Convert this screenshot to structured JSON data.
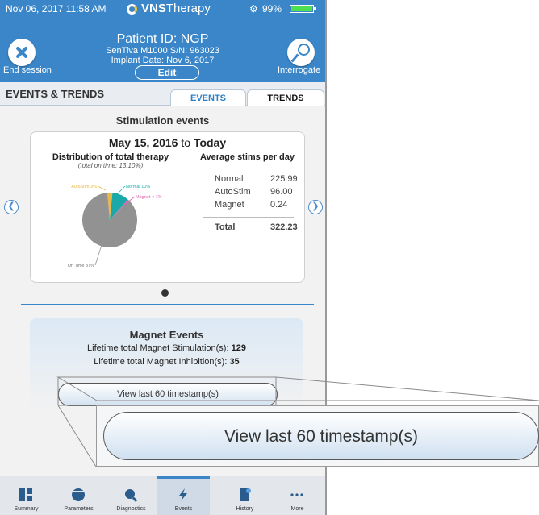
{
  "status_bar": {
    "time": "Nov 06, 2017  11:58 AM",
    "brand_bold": "VNS",
    "brand_light": "Therapy",
    "battery": "99%"
  },
  "header": {
    "patient_id": "Patient ID: NGP",
    "model": "SenTiva M1000 S/N: 963023",
    "implant_date": "Implant Date: Nov 6, 2017",
    "edit_label": "Edit",
    "end_session_label": "End session",
    "interrogate_label": "Interrogate"
  },
  "section_title": "EVENTS & TRENDS",
  "tabs": {
    "events": "EVENTS",
    "trends": "TRENDS"
  },
  "stimulation": {
    "title": "Stimulation events",
    "date_start": "May 15, 2016",
    "date_to": " to ",
    "date_end": "Today",
    "dist_title": "Distribution of total therapy",
    "dist_subtitle": "(total on time: 13.10%)",
    "avg_title": "Average stims per day",
    "avg_rows": [
      {
        "label": "Normal",
        "value": "225.99"
      },
      {
        "label": "AutoStim",
        "value": "96.00"
      },
      {
        "label": "Magnet",
        "value": "0.24"
      }
    ],
    "total_label": "Total",
    "total_value": "322.23"
  },
  "chart_data": {
    "type": "pie",
    "slices": [
      {
        "label": "Off Time 87%",
        "value": 87,
        "color": "#929292"
      },
      {
        "label": "AutoStim 3%",
        "value": 3,
        "color": "#e8b84a"
      },
      {
        "label": "Normal 10%",
        "value": 10,
        "color": "#1aa8a8"
      },
      {
        "label": "Magnet < 1%",
        "value": 0.5,
        "color": "#e05fb0"
      }
    ]
  },
  "magnet": {
    "title": "Magnet Events",
    "stim_label": "Lifetime total Magnet Stimulation(s): ",
    "stim_value": "129",
    "inhib_label": "Lifetime total Magnet Inhibition(s): ",
    "inhib_value": "35",
    "button_label": "View last 60 timestamp(s)"
  },
  "zoom_button_label": "View last 60 timestamp(s)",
  "bottom_nav": [
    {
      "label": "Summary",
      "icon": "summary-icon"
    },
    {
      "label": "Parameters",
      "icon": "parameters-icon"
    },
    {
      "label": "Diagnostics",
      "icon": "diagnostics-icon"
    },
    {
      "label": "Events",
      "icon": "events-icon"
    },
    {
      "label": "History",
      "icon": "history-icon"
    },
    {
      "label": "More",
      "icon": "more-icon"
    }
  ],
  "colors": {
    "brand_blue": "#3a86c8",
    "accent_yellow": "#f3c340",
    "battery_green": "#4fe04f"
  }
}
